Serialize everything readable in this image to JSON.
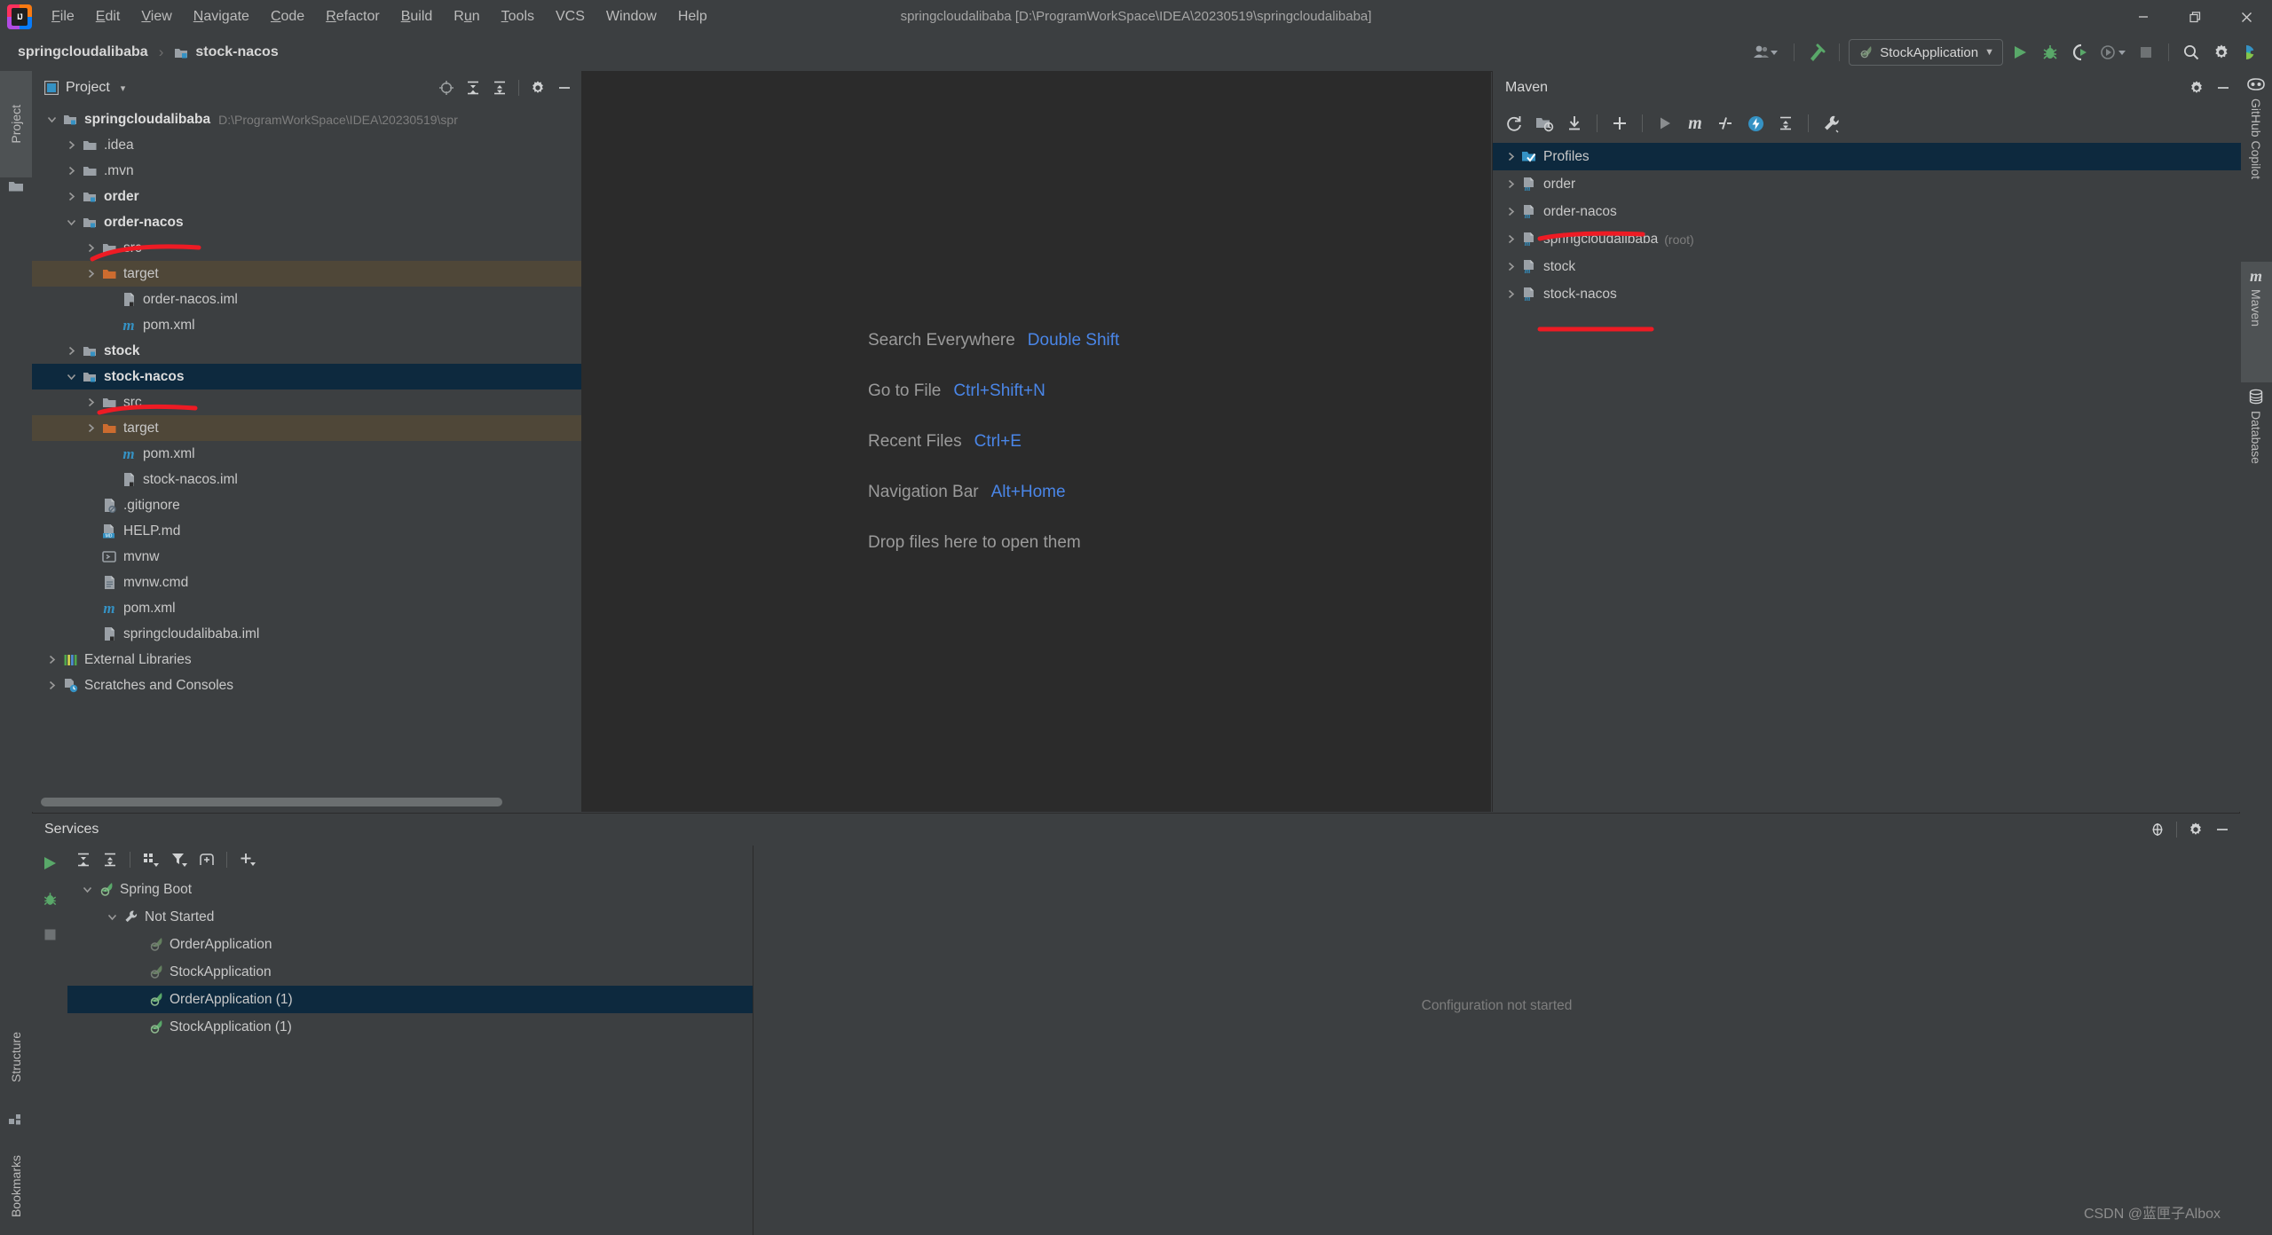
{
  "window": {
    "title": "springcloudalibaba [D:\\ProgramWorkSpace\\IDEA\\20230519\\springcloudalibaba]",
    "minimize_label": "Minimize",
    "restore_label": "Restore",
    "close_label": "Close"
  },
  "menubar": {
    "items": [
      {
        "label": "File",
        "mnemonic": "F"
      },
      {
        "label": "Edit",
        "mnemonic": "E"
      },
      {
        "label": "View",
        "mnemonic": "V"
      },
      {
        "label": "Navigate",
        "mnemonic": "N"
      },
      {
        "label": "Code",
        "mnemonic": "C"
      },
      {
        "label": "Refactor",
        "mnemonic": "R"
      },
      {
        "label": "Build",
        "mnemonic": "B"
      },
      {
        "label": "Run",
        "mnemonic": "u"
      },
      {
        "label": "Tools",
        "mnemonic": "T"
      },
      {
        "label": "VCS",
        "mnemonic": ""
      },
      {
        "label": "Window",
        "mnemonic": ""
      },
      {
        "label": "Help",
        "mnemonic": ""
      }
    ]
  },
  "navbar": {
    "breadcrumbs": [
      {
        "label": "springcloudalibaba",
        "icon": "module-icon"
      },
      {
        "label": "stock-nacos",
        "icon": "module-icon"
      }
    ],
    "separator": "›",
    "run_configuration": "StockApplication",
    "buttons": [
      {
        "name": "user-account-button",
        "icon": "user-icon"
      },
      {
        "name": "build-project-button",
        "icon": "hammer-icon"
      },
      {
        "name": "run-button",
        "icon": "play-icon"
      },
      {
        "name": "debug-button",
        "icon": "bug-icon"
      },
      {
        "name": "run-with-coverage-button",
        "icon": "coverage-icon"
      },
      {
        "name": "profiler-button",
        "icon": "profiler-icon"
      },
      {
        "name": "stop-button",
        "icon": "stop-icon"
      },
      {
        "name": "search-button",
        "icon": "search-icon"
      },
      {
        "name": "settings-button",
        "icon": "gear-icon"
      },
      {
        "name": "ide-feature-button",
        "icon": "colorful-icon"
      }
    ]
  },
  "left_toolwindows": [
    {
      "label": "Project",
      "icon": "folder-icon",
      "active": true
    },
    {
      "label": "Structure",
      "icon": "structure-icon",
      "active": false
    },
    {
      "label": "Bookmarks",
      "icon": "bookmark-icon",
      "active": false
    }
  ],
  "right_toolwindows": [
    {
      "label": "GitHub Copilot",
      "icon": "copilot-icon",
      "active": false
    },
    {
      "label": "Maven",
      "icon": "maven-m-icon",
      "active": true
    },
    {
      "label": "Database",
      "icon": "database-icon",
      "active": false
    }
  ],
  "project_panel": {
    "title": "Project",
    "dropdown": "▾",
    "header_buttons": [
      {
        "name": "select-opened-file-button",
        "icon": "crosshair-icon"
      },
      {
        "name": "expand-all-button",
        "icon": "expand-all-icon"
      },
      {
        "name": "collapse-all-button",
        "icon": "collapse-all-icon"
      },
      {
        "name": "panel-settings-button",
        "icon": "gear-icon"
      },
      {
        "name": "hide-panel-button",
        "icon": "minus-icon"
      }
    ],
    "tree": [
      {
        "label": "springcloudalibaba",
        "path": "D:\\ProgramWorkSpace\\IDEA\\20230519\\spr",
        "indent": 0,
        "arrow": "expanded",
        "icon": "module-icon",
        "bold": true,
        "state": "normal"
      },
      {
        "label": ".idea",
        "path": "",
        "indent": 1,
        "arrow": "collapsed",
        "icon": "folder-icon",
        "bold": false,
        "state": "normal"
      },
      {
        "label": ".mvn",
        "path": "",
        "indent": 1,
        "arrow": "collapsed",
        "icon": "folder-icon",
        "bold": false,
        "state": "normal"
      },
      {
        "label": "order",
        "path": "",
        "indent": 1,
        "arrow": "collapsed",
        "icon": "module-icon",
        "bold": true,
        "state": "normal"
      },
      {
        "label": "order-nacos",
        "path": "",
        "indent": 1,
        "arrow": "expanded",
        "icon": "module-icon",
        "bold": true,
        "state": "normal"
      },
      {
        "label": "src",
        "path": "",
        "indent": 2,
        "arrow": "collapsed",
        "icon": "folder-icon",
        "bold": false,
        "state": "normal"
      },
      {
        "label": "target",
        "path": "",
        "indent": 2,
        "arrow": "collapsed",
        "icon": "folder-orange-icon",
        "bold": false,
        "state": "excluded"
      },
      {
        "label": "order-nacos.iml",
        "path": "",
        "indent": 3,
        "arrow": "none",
        "icon": "iml-file-icon",
        "bold": false,
        "state": "normal"
      },
      {
        "label": "pom.xml",
        "path": "",
        "indent": 3,
        "arrow": "none",
        "icon": "maven-m-icon",
        "bold": false,
        "state": "normal"
      },
      {
        "label": "stock",
        "path": "",
        "indent": 1,
        "arrow": "collapsed",
        "icon": "module-icon",
        "bold": true,
        "state": "normal"
      },
      {
        "label": "stock-nacos",
        "path": "",
        "indent": 1,
        "arrow": "expanded",
        "icon": "module-icon",
        "bold": true,
        "state": "selected"
      },
      {
        "label": "src",
        "path": "",
        "indent": 2,
        "arrow": "collapsed",
        "icon": "folder-icon",
        "bold": false,
        "state": "normal"
      },
      {
        "label": "target",
        "path": "",
        "indent": 2,
        "arrow": "collapsed",
        "icon": "folder-orange-icon",
        "bold": false,
        "state": "excluded"
      },
      {
        "label": "pom.xml",
        "path": "",
        "indent": 3,
        "arrow": "none",
        "icon": "maven-m-icon",
        "bold": false,
        "state": "normal"
      },
      {
        "label": "stock-nacos.iml",
        "path": "",
        "indent": 3,
        "arrow": "none",
        "icon": "iml-file-icon",
        "bold": false,
        "state": "normal"
      },
      {
        "label": ".gitignore",
        "path": "",
        "indent": 2,
        "arrow": "none",
        "icon": "gitignore-file-icon",
        "bold": false,
        "state": "normal"
      },
      {
        "label": "HELP.md",
        "path": "",
        "indent": 2,
        "arrow": "none",
        "icon": "markdown-file-icon",
        "bold": false,
        "state": "normal"
      },
      {
        "label": "mvnw",
        "path": "",
        "indent": 2,
        "arrow": "none",
        "icon": "shell-file-icon",
        "bold": false,
        "state": "normal"
      },
      {
        "label": "mvnw.cmd",
        "path": "",
        "indent": 2,
        "arrow": "none",
        "icon": "text-file-icon",
        "bold": false,
        "state": "normal"
      },
      {
        "label": "pom.xml",
        "path": "",
        "indent": 2,
        "arrow": "none",
        "icon": "maven-m-icon",
        "bold": false,
        "state": "normal"
      },
      {
        "label": "springcloudalibaba.iml",
        "path": "",
        "indent": 2,
        "arrow": "none",
        "icon": "iml-file-icon",
        "bold": false,
        "state": "normal"
      },
      {
        "label": "External Libraries",
        "path": "",
        "indent": 0,
        "arrow": "collapsed",
        "icon": "libraries-icon",
        "bold": false,
        "state": "normal"
      },
      {
        "label": "Scratches and Consoles",
        "path": "",
        "indent": 0,
        "arrow": "collapsed",
        "icon": "scratches-icon",
        "bold": false,
        "state": "normal"
      }
    ]
  },
  "editor": {
    "shortcuts": [
      {
        "label": "Search Everywhere",
        "key": "Double Shift"
      },
      {
        "label": "Go to File",
        "key": "Ctrl+Shift+N"
      },
      {
        "label": "Recent Files",
        "key": "Ctrl+E"
      },
      {
        "label": "Navigation Bar",
        "key": "Alt+Home"
      }
    ],
    "drop_hint": "Drop files here to open them"
  },
  "maven_panel": {
    "title": "Maven",
    "toolbar": [
      {
        "name": "reload-all-maven-projects-button",
        "icon": "refresh-icon"
      },
      {
        "name": "add-maven-project-button",
        "icon": "folder-add-icon"
      },
      {
        "name": "download-sources-button",
        "icon": "download-icon"
      },
      {
        "name": "add-plus-button",
        "icon": "plus-icon"
      },
      {
        "name": "run-maven-build-button",
        "icon": "play-icon"
      },
      {
        "name": "execute-maven-goal-button",
        "icon": "maven-m-icon"
      },
      {
        "name": "toggle-skip-tests-button",
        "icon": "skip-tests-icon"
      },
      {
        "name": "toggle-offline-mode-button",
        "icon": "offline-bolt-icon"
      },
      {
        "name": "collapse-all-button",
        "icon": "collapse-all-icon"
      },
      {
        "name": "maven-settings-button",
        "icon": "wrench-icon"
      }
    ],
    "tree": [
      {
        "label": "Profiles",
        "suffix": "",
        "icon": "profiles-icon",
        "state": "selected"
      },
      {
        "label": "order",
        "suffix": "",
        "icon": "maven-project-icon",
        "state": "normal"
      },
      {
        "label": "order-nacos",
        "suffix": "",
        "icon": "maven-project-icon",
        "state": "normal"
      },
      {
        "label": "springcloudalibaba",
        "suffix": "(root)",
        "icon": "maven-project-icon",
        "state": "normal"
      },
      {
        "label": "stock",
        "suffix": "",
        "icon": "maven-project-icon",
        "state": "normal"
      },
      {
        "label": "stock-nacos",
        "suffix": "",
        "icon": "maven-project-icon",
        "state": "normal"
      }
    ]
  },
  "services_panel": {
    "title": "Services",
    "header_buttons": [
      {
        "name": "select-active-service-button",
        "icon": "crosshair-icon"
      },
      {
        "name": "services-settings-button",
        "icon": "gear-icon"
      },
      {
        "name": "hide-services-button",
        "icon": "minus-icon"
      }
    ],
    "gutter_buttons": [
      {
        "name": "run-service-button",
        "icon": "play-icon"
      },
      {
        "name": "debug-service-button",
        "icon": "bug-icon"
      },
      {
        "name": "stop-service-button",
        "icon": "stop-icon"
      }
    ],
    "toolbar": [
      {
        "name": "expand-all-button",
        "icon": "expand-all-icon"
      },
      {
        "name": "collapse-all-button",
        "icon": "collapse-all-icon"
      },
      {
        "name": "group-by-button",
        "icon": "group-by-icon"
      },
      {
        "name": "filter-button",
        "icon": "filter-icon"
      },
      {
        "name": "add-tab-button",
        "icon": "add-tab-icon"
      },
      {
        "name": "add-service-button",
        "icon": "plus-icon"
      }
    ],
    "tree": [
      {
        "label": "Spring Boot",
        "indent": 0,
        "arrow": "expanded",
        "icon": "spring-boot-icon",
        "state": "normal"
      },
      {
        "label": "Not Started",
        "indent": 1,
        "arrow": "expanded",
        "icon": "wrench-icon",
        "state": "normal"
      },
      {
        "label": "OrderApplication",
        "indent": 2,
        "arrow": "none",
        "icon": "spring-boot-dim-icon",
        "state": "normal"
      },
      {
        "label": "StockApplication",
        "indent": 2,
        "arrow": "none",
        "icon": "spring-boot-dim-icon",
        "state": "normal"
      },
      {
        "label": "OrderApplication (1)",
        "indent": 2,
        "arrow": "none",
        "icon": "spring-boot-icon",
        "state": "selected"
      },
      {
        "label": "StockApplication (1)",
        "indent": 2,
        "arrow": "none",
        "icon": "spring-boot-icon",
        "state": "normal"
      }
    ],
    "detail_message": "Configuration not started"
  },
  "watermark": "CSDN @蓝匣子Albox",
  "colors": {
    "background": "#3c3f41",
    "editor_background": "#2b2b2b",
    "selection": "#0d293e",
    "excluded_row": "#4f4738",
    "accent_blue": "#4a86e8",
    "annotation_red": "#ee1b24",
    "text": "#bbbbbb",
    "green_run": "#59a869",
    "orange_folder": "#cc7832"
  },
  "annotations": [
    {
      "name": "red-underline-order-nacos-tree"
    },
    {
      "name": "red-underline-stock-nacos-tree"
    },
    {
      "name": "red-underline-order-nacos-maven"
    },
    {
      "name": "red-underline-maven-tree-bottom"
    }
  ]
}
